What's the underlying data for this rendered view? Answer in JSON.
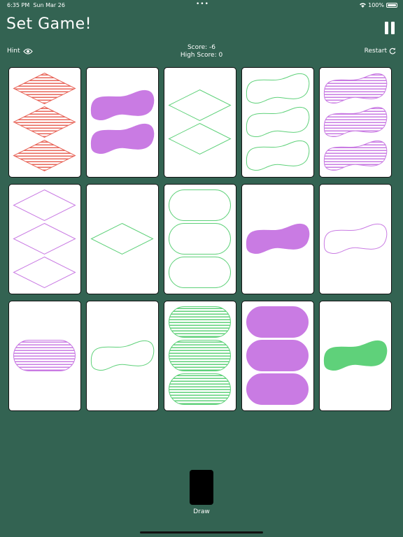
{
  "status_bar": {
    "time": "6:35 PM",
    "date": "Sun Mar 26",
    "battery": "100%"
  },
  "header": {
    "title": "Set Game!"
  },
  "toolbar": {
    "hint_label": "Hint",
    "score_text": "Score: -6",
    "high_score_text": "High Score: 0",
    "restart_label": "Restart"
  },
  "colors": {
    "red": "#e8665a",
    "green": "#5fd17a",
    "purple": "#c97be3",
    "background": "#336352"
  },
  "cards": [
    {
      "shape": "diamond",
      "count": 3,
      "shading": "striped",
      "color": "red"
    },
    {
      "shape": "squiggle",
      "count": 2,
      "shading": "solid",
      "color": "purple"
    },
    {
      "shape": "diamond",
      "count": 2,
      "shading": "open",
      "color": "green"
    },
    {
      "shape": "squiggle",
      "count": 3,
      "shading": "open",
      "color": "green"
    },
    {
      "shape": "squiggle",
      "count": 3,
      "shading": "striped",
      "color": "purple"
    },
    {
      "shape": "diamond",
      "count": 3,
      "shading": "open",
      "color": "purple"
    },
    {
      "shape": "diamond",
      "count": 1,
      "shading": "open",
      "color": "green"
    },
    {
      "shape": "oval",
      "count": 3,
      "shading": "open",
      "color": "green"
    },
    {
      "shape": "squiggle",
      "count": 1,
      "shading": "solid",
      "color": "purple"
    },
    {
      "shape": "squiggle",
      "count": 1,
      "shading": "open",
      "color": "purple"
    },
    {
      "shape": "oval",
      "count": 1,
      "shading": "striped",
      "color": "purple"
    },
    {
      "shape": "squiggle",
      "count": 1,
      "shading": "open",
      "color": "green"
    },
    {
      "shape": "oval",
      "count": 3,
      "shading": "striped",
      "color": "green"
    },
    {
      "shape": "oval",
      "count": 3,
      "shading": "solid",
      "color": "purple"
    },
    {
      "shape": "squiggle",
      "count": 1,
      "shading": "solid",
      "color": "green"
    }
  ],
  "deck": {
    "draw_label": "Draw"
  }
}
